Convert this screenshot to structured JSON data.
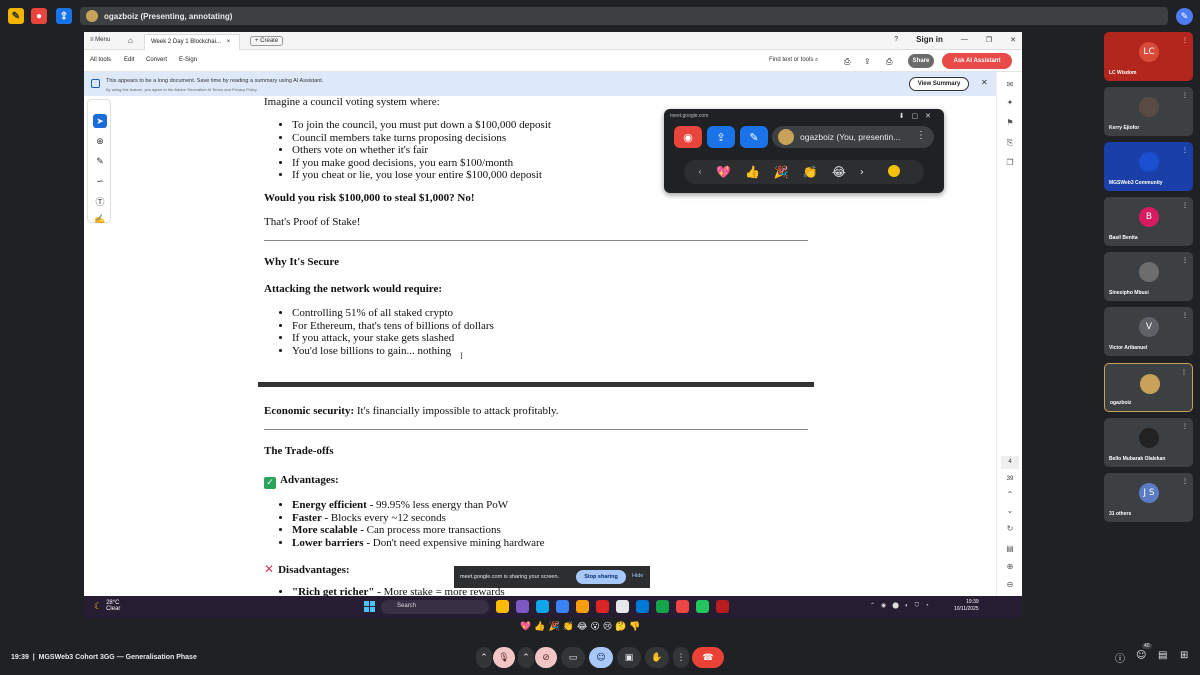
{
  "meet": {
    "presenter_label": "ogazboiz (Presenting, annotating)",
    "time": "19:39",
    "separator": "|",
    "meeting_name": "MGSWeb3 Cohort 3GG — Generalisation Phase",
    "participants_badge": "40"
  },
  "acrobat": {
    "menu_label": "Menu",
    "tab_title": "Week 2 Day 1 Blockchai...",
    "create_label": "+ Create",
    "signin_label": "Sign in",
    "toolbar": [
      "All tools",
      "Edit",
      "Convert",
      "E-Sign"
    ],
    "find_label": "Find text or tools",
    "share_label": "Share",
    "ai_label": "Ask AI Assistant",
    "banner_text": "This appears to be a long document. Save time by reading a summary using AI Assistant.",
    "banner_subtext": "By using this feature, you agree to the Adobe Generative AI Terms and Privacy Policy",
    "view_summary": "View Summary",
    "page_current": "4",
    "page_total": "39"
  },
  "document": {
    "intro": "Imagine a council voting system where:",
    "council_list": [
      "To join the council, you must put down a $100,000 deposit",
      "Council members take turns proposing decisions",
      "Others vote on whether it's fair",
      "If you make good decisions, you earn $100/month",
      "If you cheat or lie, you lose your entire $100,000 deposit"
    ],
    "question": "Would you risk $100,000 to steal $1,000? No!",
    "pos_statement": "That's Proof of Stake!",
    "why_secure": "Why It's Secure",
    "attack_heading": "Attacking the network would require:",
    "attack_list": [
      "Controlling 51% of all staked crypto",
      "For Ethereum, that's tens of billions of dollars",
      "If you attack, your stake gets slashed",
      "You'd lose billions to gain... nothing"
    ],
    "econ_bold": "Economic security:",
    "econ_text": " It's financially impossible to attack profitably.",
    "tradeoffs": "The Trade-offs",
    "advantages": "Advantages:",
    "adv_list": [
      {
        "b": "Energy efficient -",
        "t": " 99.95% less energy than PoW"
      },
      {
        "b": "Faster -",
        "t": " Blocks every ~12 seconds"
      },
      {
        "b": "More scalable -",
        "t": " Can process more transactions"
      },
      {
        "b": "Lower barriers -",
        "t": " Don't need expensive mining hardware"
      }
    ],
    "disadvantages": "Disadvantages:",
    "disadv_first_b": "\"Rich get richer\" -",
    "disadv_first_t": " More stake = more rewards"
  },
  "float_panel": {
    "url": "meet.google.com",
    "presenter": "ogazboiz (You, presentin...",
    "reactions": [
      "💖",
      "👍",
      "🎉",
      "👏",
      "😂"
    ]
  },
  "share_bar": {
    "text": "meet.google.com is sharing your screen.",
    "stop": "Stop sharing",
    "hide": "Hide"
  },
  "taskbar": {
    "temp": "28°C",
    "condition": "Clear",
    "search": "Search",
    "time": "19:39",
    "date": "10/11/2025"
  },
  "participants": [
    {
      "name": "LC Wisdom",
      "initials": "LC",
      "bg": "#b3261e",
      "circle": "#d84a3a"
    },
    {
      "name": "Kerry Ejiofor",
      "initials": "",
      "bg": "#3c4043",
      "circle": "#5a4a44"
    },
    {
      "name": "MGSWeb3 Community",
      "initials": "",
      "bg": "#1a3fa8",
      "circle": "#1b4fd1"
    },
    {
      "name": "Basil Benita",
      "initials": "B",
      "bg": "#3c4043",
      "circle": "#d81b60"
    },
    {
      "name": "Sinesipho Mbusi",
      "initials": "",
      "bg": "#3c4043",
      "circle": "#6d6d6d"
    },
    {
      "name": "Victor Aribanuel",
      "initials": "V",
      "bg": "#3c4043",
      "circle": "#5f6368"
    },
    {
      "name": "ogazboiz",
      "initials": "",
      "bg": "#3c4043",
      "circle": "#c9a25a"
    },
    {
      "name": "Bello Mubarak Olalekan",
      "initials": "",
      "bg": "#3c4043",
      "circle": "#222"
    },
    {
      "name": "31 others",
      "initials": "J S",
      "bg": "#3c4043",
      "circle": "#5b7cc4"
    }
  ],
  "bottom_reactions": [
    "💖",
    "👍",
    "🎉",
    "👏",
    "😂",
    "😮",
    "😢",
    "🤔",
    "👎"
  ]
}
